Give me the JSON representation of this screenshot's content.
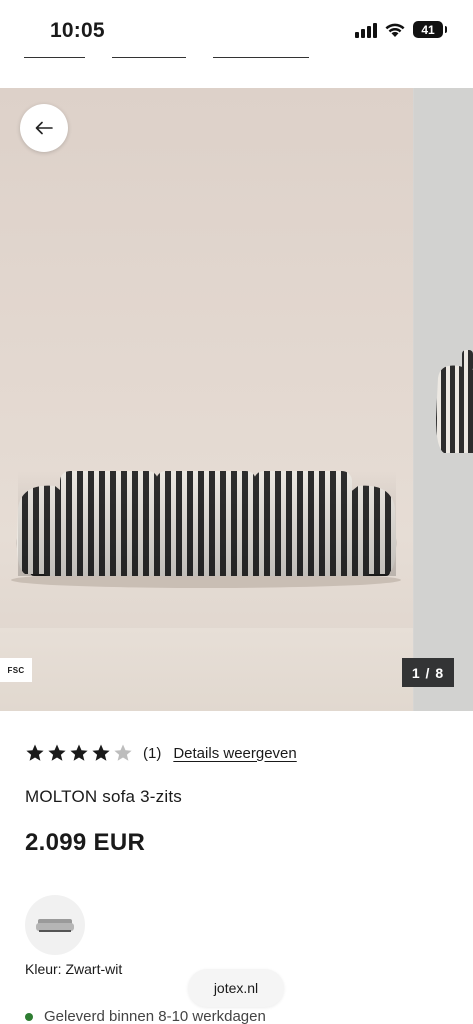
{
  "status_bar": {
    "time": "10:05",
    "battery": "41"
  },
  "gallery": {
    "fsc_label": "FSC",
    "counter": "1 / 8",
    "back_icon": "arrow-left-icon"
  },
  "product": {
    "rating": 4,
    "rating_max": 5,
    "review_count": "(1)",
    "details_link": "Details weergeven",
    "title": "MOLTON sofa 3-zits",
    "price": "2.099 EUR",
    "color_label": "Kleur: Zwart-wit",
    "delivery": "Geleverd binnen 8-10 werkdagen"
  },
  "browser": {
    "domain": "jotex.nl"
  },
  "colors": {
    "in_stock": "#2e7d32",
    "star_filled": "#1a1a1a",
    "star_empty": "#bdbdbd",
    "counter_bg": "#333435"
  }
}
